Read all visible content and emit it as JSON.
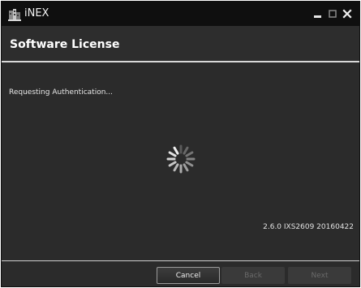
{
  "window": {
    "title": "iNEX",
    "icon": "inex-app-icon",
    "controls": [
      "minimize-icon",
      "maximize-icon",
      "close-icon"
    ]
  },
  "header": {
    "title": "Software License"
  },
  "main": {
    "status": "Requesting Authentication...",
    "spinner": "loading-spinner-icon",
    "version": "2.6.0 IXS2609 20160422"
  },
  "footer": {
    "cancel_label": "Cancel",
    "back_label": "Back",
    "next_label": "Next"
  },
  "colors": {
    "background": "#2b2b2b",
    "titlebar": "#0f0f0f",
    "text": "#ffffff",
    "disabled_text": "#6a6a6a"
  }
}
